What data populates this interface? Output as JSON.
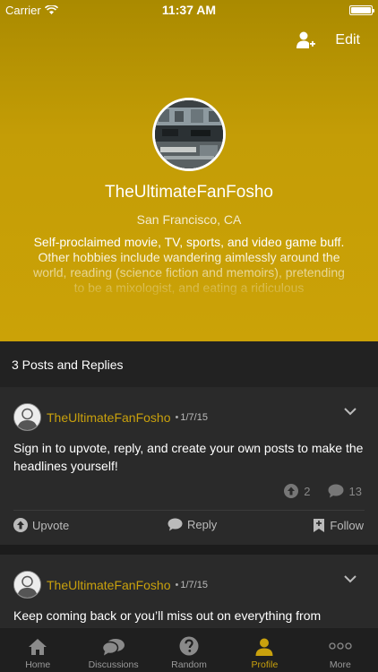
{
  "status_bar": {
    "carrier": "Carrier",
    "time": "11:37 AM",
    "battery_level": 1.0
  },
  "header": {
    "edit_label": "Edit",
    "add_user_icon": "add-user-icon",
    "username": "TheUltimateFanFosho",
    "location": "San Francisco, CA",
    "bio": "Self-proclaimed movie, TV, sports, and video game buff. Other hobbies include wandering aimlessly around the world, reading (science fiction and memoirs), pretending to be a mixologist, and eating a ridiculous"
  },
  "posts_count_label": "3 Posts and Replies",
  "posts": [
    {
      "author": "TheUltimateFanFosho",
      "dot": "•",
      "date": "1/7/15",
      "body": "Sign in to upvote, reply, and create your own posts to make the headlines yourself!",
      "upvotes": "2",
      "comments": "13",
      "actions": {
        "upvote": "Upvote",
        "reply": "Reply",
        "follow": "Follow"
      }
    },
    {
      "author": "TheUltimateFanFosho",
      "dot": "•",
      "date": "1/7/15",
      "body": "Keep coming back or you’ll miss out on everything from"
    }
  ],
  "tabbar": {
    "tabs": [
      {
        "label": "Home",
        "icon": "home-icon"
      },
      {
        "label": "Discussions",
        "icon": "chat-bubbles-icon"
      },
      {
        "label": "Random",
        "icon": "question-icon"
      },
      {
        "label": "Profile",
        "icon": "person-icon",
        "active": true
      },
      {
        "label": "More",
        "icon": "more-dots-icon"
      }
    ]
  },
  "colors": {
    "accent": "#c9a10d",
    "header": "#c49d06",
    "background": "#1c1c1c",
    "card": "#2a2a2a"
  }
}
